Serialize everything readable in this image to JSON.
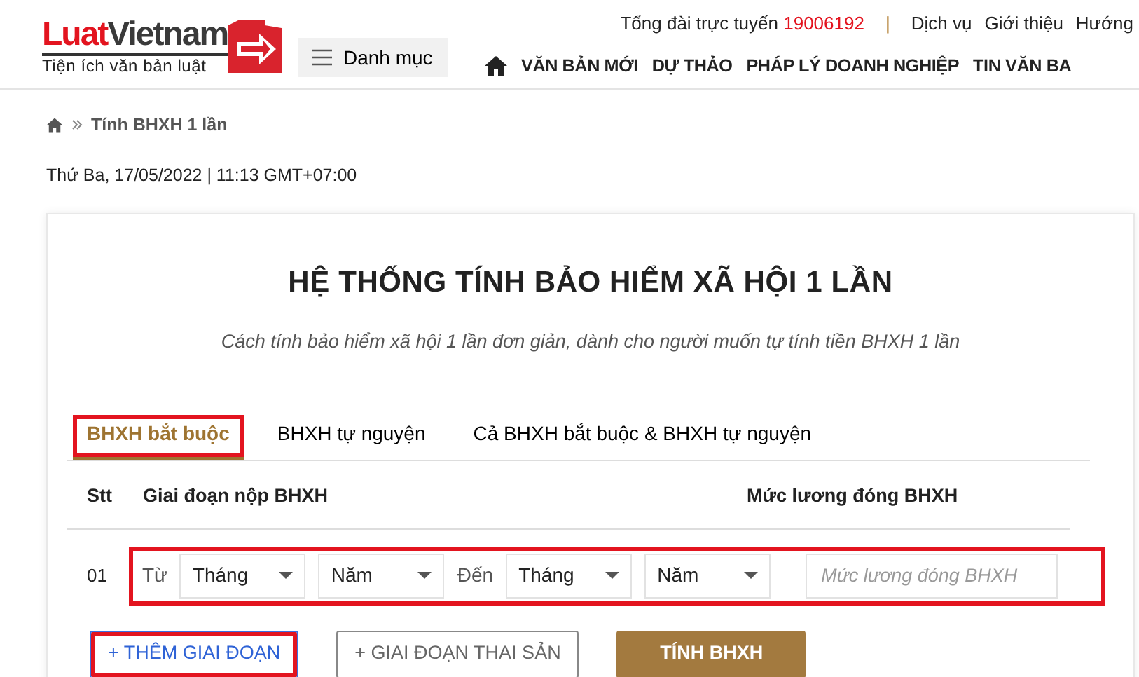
{
  "header": {
    "logo": {
      "brand_part_1": "Luat",
      "brand_part_2": "Vietnam",
      "tagline": "Tiện ích văn bản luật"
    },
    "menu_button": "Danh mục",
    "hotline_label": "Tổng đài trực tuyến",
    "hotline_number": "19006192",
    "separator": "|",
    "top_links": [
      "Dịch vụ",
      "Giới thiệu",
      "Hướng"
    ],
    "nav": [
      "VĂN BẢN MỚI",
      "DỰ THẢO",
      "PHÁP LÝ DOANH NGHIỆP",
      "TIN VĂN BA"
    ]
  },
  "breadcrumb": {
    "current": "Tính BHXH 1 lần"
  },
  "date": "Thứ Ba, 17/05/2022 | 11:13 GMT+07:00",
  "calculator": {
    "title": "HỆ THỐNG TÍNH BẢO HIỂM XÃ HỘI 1 LẦN",
    "subtitle": "Cách tính bảo hiểm xã hội 1 lần đơn giản, dành cho người muốn tự tính tiền BHXH 1 lần",
    "tabs": [
      {
        "label": "BHXH bắt buộc",
        "selected": true,
        "highlighted": true
      },
      {
        "label": "BHXH tự nguyện",
        "selected": false,
        "highlighted": false
      },
      {
        "label": "Cả BHXH bắt buộc & BHXH tự nguyện",
        "selected": false,
        "highlighted": false
      }
    ],
    "columns": [
      "Stt",
      "Giai đoạn nộp BHXH",
      "Mức lương đóng BHXH"
    ],
    "rows": [
      {
        "stt": "01",
        "highlighted": true,
        "from_label": "Từ",
        "from_month": "Tháng",
        "from_year": "Năm",
        "to_label": "Đến",
        "to_month": "Tháng",
        "to_year": "Năm",
        "salary_placeholder": "Mức lương đóng BHXH"
      }
    ],
    "buttons": [
      {
        "label": "+ THÊM GIAI ĐOẠN",
        "kind": "primary-outline",
        "highlighted": true
      },
      {
        "label": "+ GIAI ĐOẠN THAI SẢN",
        "kind": "secondary-outline",
        "highlighted": false
      },
      {
        "label": "TÍNH BHXH",
        "kind": "solid",
        "highlighted": false
      }
    ]
  }
}
